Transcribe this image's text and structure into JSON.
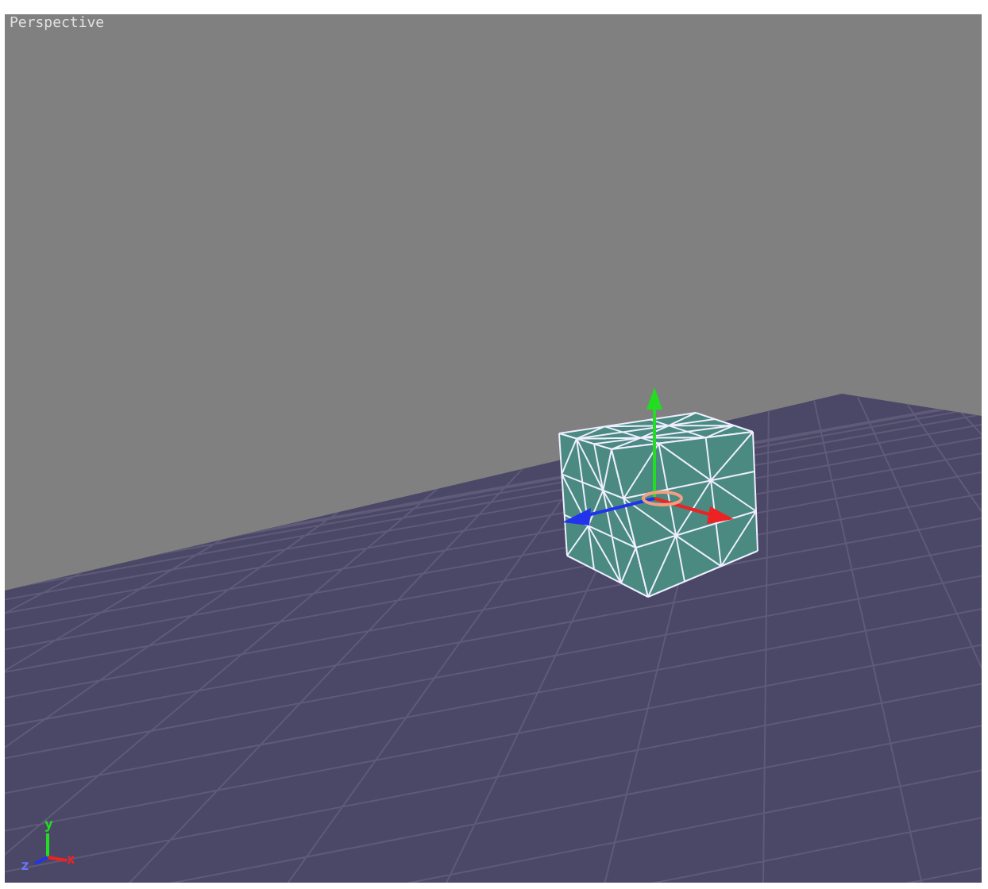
{
  "viewport": {
    "title": "Perspective"
  },
  "axis_labels": [
    {
      "kind": "y",
      "text": "y"
    },
    {
      "kind": "z",
      "text": "z"
    },
    {
      "kind": "x",
      "text": "x"
    }
  ]
}
